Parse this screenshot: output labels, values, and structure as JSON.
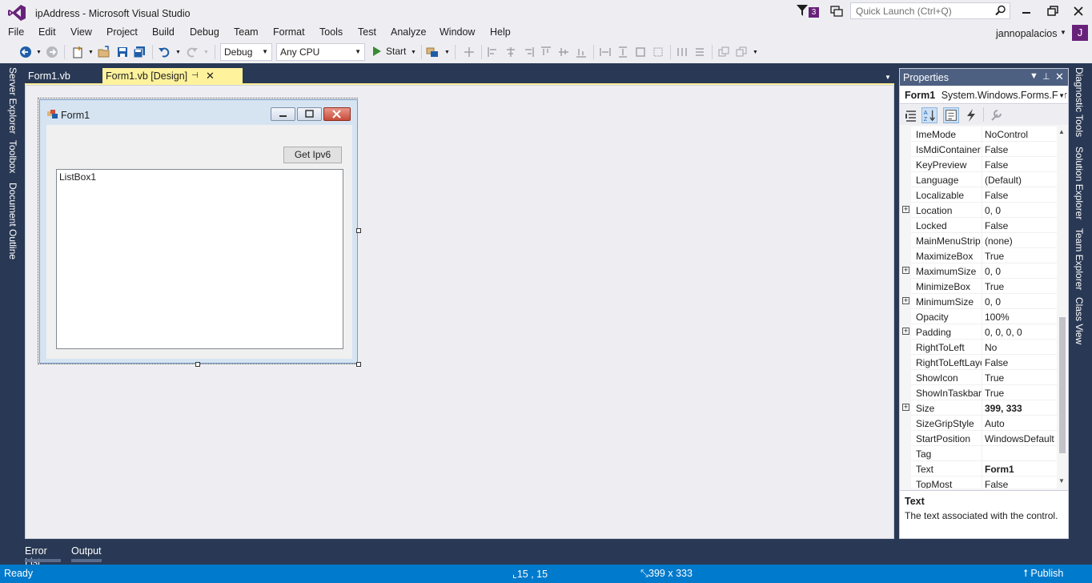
{
  "window": {
    "title": "ipAddress - Microsoft Visual Studio",
    "notification_count": "3",
    "quick_launch_placeholder": "Quick Launch (Ctrl+Q)"
  },
  "menu": {
    "items": [
      "File",
      "Edit",
      "View",
      "Project",
      "Build",
      "Debug",
      "Team",
      "Format",
      "Tools",
      "Test",
      "Analyze",
      "Window",
      "Help"
    ],
    "user_name": "jannopalacios",
    "user_initial": "J"
  },
  "toolbar": {
    "config": "Debug",
    "platform": "Any CPU",
    "start_label": "Start"
  },
  "left_dock": {
    "tabs": [
      "Server Explorer",
      "Toolbox",
      "Document Outline"
    ]
  },
  "right_dock": {
    "tabs": [
      "Diagnostic Tools",
      "Solution Explorer",
      "Team Explorer",
      "Class View"
    ]
  },
  "document_tabs": {
    "tab1": "Form1.vb",
    "tab2": "Form1.vb [Design]"
  },
  "designer": {
    "form_title": "Form1",
    "button_label": "Get Ipv6",
    "listbox_label": "ListBox1"
  },
  "properties": {
    "header": "Properties",
    "object_name": "Form1",
    "object_type": "System.Windows.Forms.For",
    "rows": [
      {
        "name": "ImeMode",
        "value": "NoControl",
        "expandable": false,
        "bold": false
      },
      {
        "name": "IsMdiContainer",
        "value": "False",
        "expandable": false,
        "bold": false
      },
      {
        "name": "KeyPreview",
        "value": "False",
        "expandable": false,
        "bold": false
      },
      {
        "name": "Language",
        "value": "(Default)",
        "expandable": false,
        "bold": false
      },
      {
        "name": "Localizable",
        "value": "False",
        "expandable": false,
        "bold": false
      },
      {
        "name": "Location",
        "value": "0, 0",
        "expandable": true,
        "bold": false
      },
      {
        "name": "Locked",
        "value": "False",
        "expandable": false,
        "bold": false
      },
      {
        "name": "MainMenuStrip",
        "value": "(none)",
        "expandable": false,
        "bold": false
      },
      {
        "name": "MaximizeBox",
        "value": "True",
        "expandable": false,
        "bold": false
      },
      {
        "name": "MaximumSize",
        "value": "0, 0",
        "expandable": true,
        "bold": false
      },
      {
        "name": "MinimizeBox",
        "value": "True",
        "expandable": false,
        "bold": false
      },
      {
        "name": "MinimumSize",
        "value": "0, 0",
        "expandable": true,
        "bold": false
      },
      {
        "name": "Opacity",
        "value": "100%",
        "expandable": false,
        "bold": false
      },
      {
        "name": "Padding",
        "value": "0, 0, 0, 0",
        "expandable": true,
        "bold": false
      },
      {
        "name": "RightToLeft",
        "value": "No",
        "expandable": false,
        "bold": false
      },
      {
        "name": "RightToLeftLayout",
        "value": "False",
        "expandable": false,
        "bold": false
      },
      {
        "name": "ShowIcon",
        "value": "True",
        "expandable": false,
        "bold": false
      },
      {
        "name": "ShowInTaskbar",
        "value": "True",
        "expandable": false,
        "bold": false
      },
      {
        "name": "Size",
        "value": "399, 333",
        "expandable": true,
        "bold": true
      },
      {
        "name": "SizeGripStyle",
        "value": "Auto",
        "expandable": false,
        "bold": false
      },
      {
        "name": "StartPosition",
        "value": "WindowsDefault",
        "expandable": false,
        "bold": false
      },
      {
        "name": "Tag",
        "value": "",
        "expandable": false,
        "bold": false
      },
      {
        "name": "Text",
        "value": "Form1",
        "expandable": false,
        "bold": true,
        "selected": true
      },
      {
        "name": "TopMost",
        "value": "False",
        "expandable": false,
        "bold": false
      }
    ],
    "desc_title": "Text",
    "desc_text": "The text associated with the control."
  },
  "bottom_tabs": {
    "error_list": "Error List",
    "output": "Output"
  },
  "status": {
    "ready": "Ready",
    "position": "15 , 15",
    "size": "399 x 333",
    "publish": "Publish"
  },
  "colors": {
    "accent": "#68217a",
    "status_bar": "#007acc",
    "dock_bg": "#293955",
    "active_tab": "#fff29d"
  }
}
